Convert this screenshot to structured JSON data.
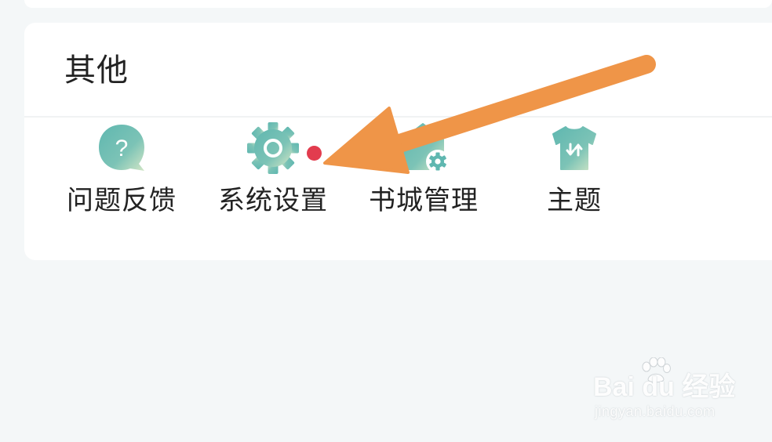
{
  "section": {
    "title": "其他"
  },
  "items": [
    {
      "label": "问题反馈",
      "icon": "feedback-question-icon"
    },
    {
      "label": "系统设置",
      "icon": "settings-gear-icon",
      "badge": "red-dot"
    },
    {
      "label": "书城管理",
      "icon": "bookstore-manage-icon"
    },
    {
      "label": "主题",
      "icon": "theme-shirt-icon"
    }
  ],
  "colors": {
    "icon_gradient_start": "#5fb7b0",
    "icon_gradient_end": "#cfe3c3",
    "badge": "#e23c4e",
    "arrow": "#ef9548",
    "page_background": "#f4f7f8",
    "card_background": "#ffffff"
  },
  "watermark": {
    "logo_text": "Bai du 经验",
    "url": "jingyan.baidu.com"
  }
}
